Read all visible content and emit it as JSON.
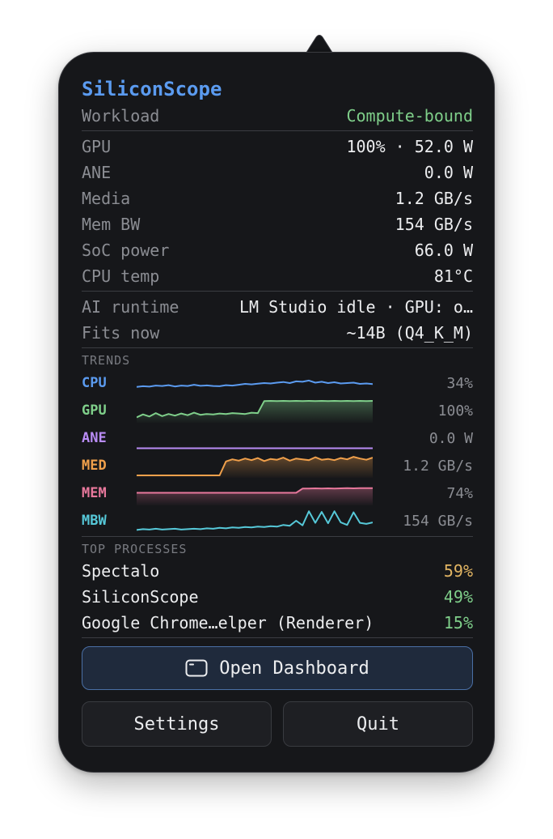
{
  "app": {
    "title": "SiliconScope"
  },
  "workload": {
    "label": "Workload",
    "value": "Compute-bound",
    "color": "#7fcf8a"
  },
  "metrics": [
    {
      "label": "GPU",
      "value": "100% · 52.0 W"
    },
    {
      "label": "ANE",
      "value": "0.0 W"
    },
    {
      "label": "Media",
      "value": "1.2 GB/s"
    },
    {
      "label": "Mem BW",
      "value": "154 GB/s"
    },
    {
      "label": "SoC power",
      "value": "66.0 W"
    },
    {
      "label": "CPU temp",
      "value": "81°C"
    }
  ],
  "ai": {
    "runtime_label": "AI runtime",
    "runtime_value": "LM Studio idle · GPU: o…",
    "fits_label": "Fits now",
    "fits_value": "~14B (Q4_K_M)"
  },
  "trends": {
    "heading": "TRENDS",
    "rows": [
      {
        "label": "CPU",
        "value": "34%",
        "color": "#5b9bf0",
        "fill": false,
        "level": [
          0.32,
          0.35,
          0.33,
          0.38,
          0.36,
          0.4,
          0.34,
          0.38,
          0.36,
          0.42,
          0.37,
          0.39,
          0.36,
          0.35,
          0.4,
          0.38,
          0.42,
          0.46,
          0.44,
          0.47,
          0.5,
          0.48,
          0.52,
          0.55,
          0.5,
          0.58,
          0.56,
          0.62,
          0.52,
          0.56,
          0.5,
          0.54,
          0.48,
          0.5,
          0.52,
          0.46,
          0.48,
          0.45
        ]
      },
      {
        "label": "GPU",
        "value": "100%",
        "color": "#7fcf8a",
        "fill": true,
        "level": [
          0.18,
          0.32,
          0.22,
          0.38,
          0.24,
          0.34,
          0.26,
          0.36,
          0.28,
          0.4,
          0.3,
          0.34,
          0.32,
          0.36,
          0.34,
          0.38,
          0.36,
          0.34,
          0.4,
          0.38,
          0.95,
          0.96,
          0.95,
          0.96,
          0.95,
          0.96,
          0.95,
          0.96,
          0.95,
          0.96,
          0.95,
          0.96,
          0.95,
          0.96,
          0.95,
          0.96,
          0.95,
          0.96
        ]
      },
      {
        "label": "ANE",
        "value": "0.0 W",
        "color": "#b98cf5",
        "fill": false,
        "level": [
          0.02,
          0.02,
          0.02,
          0.02,
          0.02,
          0.02,
          0.02,
          0.02,
          0.02,
          0.02,
          0.02,
          0.02,
          0.02,
          0.02,
          0.02,
          0.02,
          0.02,
          0.02,
          0.02,
          0.02,
          0.02,
          0.02,
          0.02,
          0.02,
          0.02,
          0.02,
          0.02,
          0.02,
          0.02,
          0.02,
          0.02,
          0.02,
          0.02,
          0.02,
          0.02,
          0.02,
          0.02,
          0.02
        ]
      },
      {
        "label": "MED",
        "value": "1.2 GB/s",
        "color": "#f0a04b",
        "fill": true,
        "level": [
          0.04,
          0.04,
          0.04,
          0.04,
          0.04,
          0.04,
          0.04,
          0.04,
          0.04,
          0.04,
          0.04,
          0.04,
          0.04,
          0.04,
          0.7,
          0.8,
          0.74,
          0.84,
          0.76,
          0.86,
          0.72,
          0.82,
          0.78,
          0.88,
          0.74,
          0.84,
          0.8,
          0.76,
          0.9,
          0.78,
          0.82,
          0.76,
          0.86,
          0.8,
          0.92,
          0.84,
          0.78,
          0.88
        ]
      },
      {
        "label": "MEM",
        "value": "74%",
        "color": "#e8789c",
        "fill": true,
        "level": [
          0.52,
          0.52,
          0.52,
          0.52,
          0.52,
          0.52,
          0.52,
          0.52,
          0.52,
          0.52,
          0.52,
          0.52,
          0.52,
          0.52,
          0.52,
          0.52,
          0.52,
          0.52,
          0.52,
          0.52,
          0.52,
          0.52,
          0.52,
          0.52,
          0.52,
          0.52,
          0.72,
          0.72,
          0.73,
          0.72,
          0.73,
          0.72,
          0.73,
          0.74,
          0.73,
          0.74,
          0.74,
          0.74
        ]
      },
      {
        "label": "MBW",
        "value": "154 GB/s",
        "color": "#56c8d8",
        "fill": false,
        "level": [
          0.06,
          0.1,
          0.08,
          0.12,
          0.08,
          0.1,
          0.12,
          0.08,
          0.1,
          0.12,
          0.1,
          0.14,
          0.12,
          0.16,
          0.14,
          0.18,
          0.16,
          0.2,
          0.18,
          0.22,
          0.2,
          0.24,
          0.22,
          0.3,
          0.26,
          0.5,
          0.28,
          0.95,
          0.4,
          0.92,
          0.38,
          0.95,
          0.42,
          0.3,
          0.9,
          0.4,
          0.35,
          0.42
        ]
      }
    ]
  },
  "processes": {
    "heading": "TOP PROCESSES",
    "rows": [
      {
        "name": "Spectalo",
        "value": "59%",
        "color": "#e2b563"
      },
      {
        "name": "SiliconScope",
        "value": "49%",
        "color": "#7fcf8a"
      },
      {
        "name": "Google Chrome…elper (Renderer)",
        "value": "15%",
        "color": "#7fcf8a"
      }
    ]
  },
  "buttons": {
    "dashboard": {
      "label": "Open Dashboard",
      "icon": "window-icon"
    },
    "settings": "Settings",
    "quit": "Quit"
  }
}
